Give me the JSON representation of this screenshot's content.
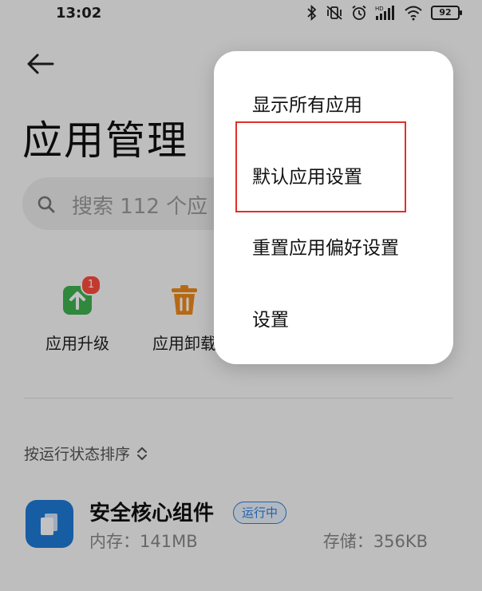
{
  "status_bar": {
    "time": "13:02",
    "battery": "92",
    "icons": [
      "bluetooth-icon",
      "vibrate-icon",
      "alarm-icon",
      "hd-signal-icon",
      "wifi-icon",
      "battery-icon"
    ]
  },
  "header": {
    "back_icon": "arrow-left-icon",
    "title": "应用管理"
  },
  "search": {
    "placeholder": "搜索 112 个应"
  },
  "tools": [
    {
      "label": "应用升级",
      "icon": "upgrade-icon",
      "badge": "1",
      "color": "#3fb34f"
    },
    {
      "label": "应用卸载",
      "icon": "trash-icon",
      "color": "#f08a1c"
    }
  ],
  "sort": {
    "label": "按运行状态排序",
    "icon": "sort-chevrons-icon"
  },
  "app_list": [
    {
      "name": "安全核心组件",
      "status": "运行中",
      "memory": "内存：141MB",
      "storage": "存储：356KB",
      "icon_color": "#1f7bd8"
    }
  ],
  "menu": {
    "items": [
      "显示所有应用",
      "默认应用设置",
      "重置应用偏好设置",
      "设置"
    ],
    "highlight_color": "#e0302a"
  }
}
